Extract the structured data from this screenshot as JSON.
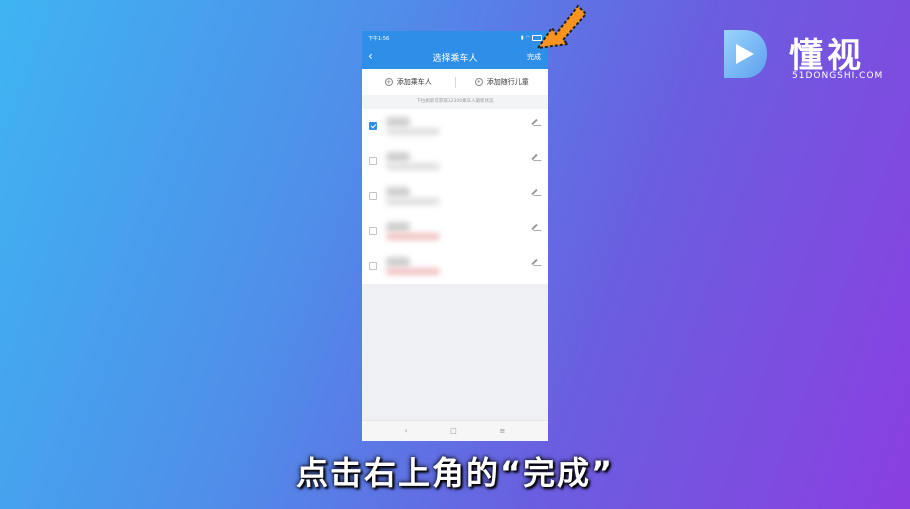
{
  "status_bar": {
    "time": "下午1:56"
  },
  "nav": {
    "title": "选择乘车人",
    "done": "完成",
    "back": "‹"
  },
  "actions": {
    "add_passenger": "添加乘车人",
    "add_child": "添加随行儿童"
  },
  "hint": "下拉刷新可获取12306乘车人最新状态",
  "passengers": [
    {
      "checked": true
    },
    {
      "checked": false
    },
    {
      "checked": false
    },
    {
      "checked": false
    },
    {
      "checked": false
    }
  ],
  "bottom_nav": {
    "back": "‹",
    "home": "□",
    "menu": "≡"
  },
  "logo": {
    "name": "懂视",
    "site": "51DONGSHI.COM"
  },
  "caption": "点击右上角的“完成”",
  "colors": {
    "accent": "#2f8fe8",
    "arrow": "#f7941d"
  }
}
